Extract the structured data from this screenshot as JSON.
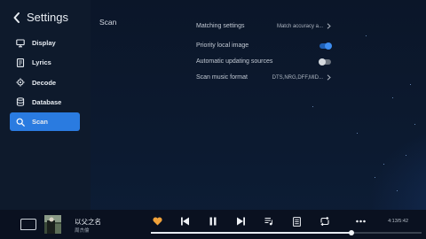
{
  "header": {
    "title": "Settings"
  },
  "sidebar": {
    "items": [
      {
        "label": "Display",
        "icon": "monitor-icon",
        "active": false
      },
      {
        "label": "Lyrics",
        "icon": "lyrics-icon",
        "active": false
      },
      {
        "label": "Decode",
        "icon": "chip-icon",
        "active": false
      },
      {
        "label": "Database",
        "icon": "database-icon",
        "active": false
      },
      {
        "label": "Scan",
        "icon": "search-icon",
        "active": true
      }
    ]
  },
  "content": {
    "section_title": "Scan",
    "settings": [
      {
        "label": "Matching settings",
        "type": "link",
        "value": "Match accuracy a..."
      },
      {
        "label": "Priority local image",
        "type": "toggle",
        "on": true
      },
      {
        "label": "Automatic updating sources",
        "type": "toggle",
        "on": false
      },
      {
        "label": "Scan music format",
        "type": "link",
        "value": "DTS,NRG,DFF,MID..."
      }
    ]
  },
  "player": {
    "song_title": "以父之名",
    "artist": "周杰倫",
    "time": "4:13/5:42",
    "progress": 0.74,
    "favorite": true
  },
  "colors": {
    "accent": "#2a7be0",
    "favorite": "#f0a23a"
  }
}
